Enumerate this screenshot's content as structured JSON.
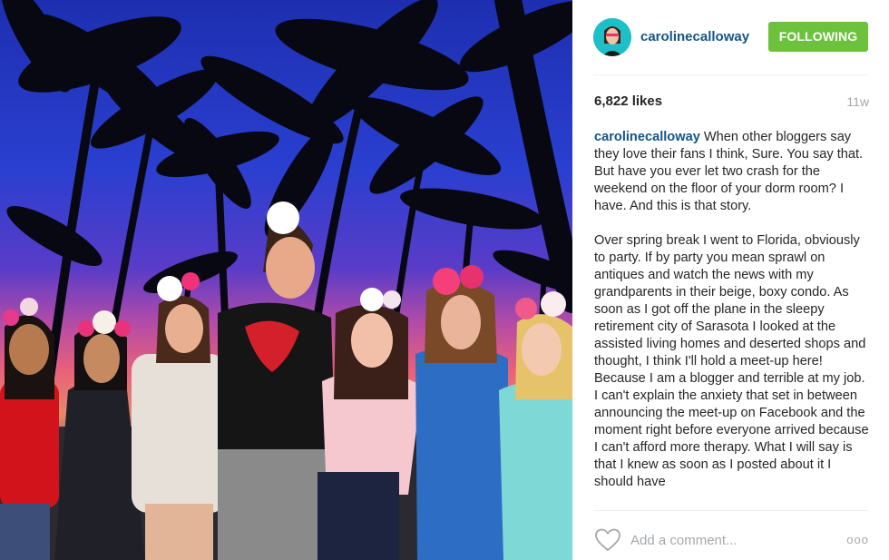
{
  "post": {
    "username": "carolinecalloway",
    "follow_label": "FOLLOWING",
    "likes": "6,822 likes",
    "time_ago": "11w",
    "caption_username": "carolinecalloway",
    "caption_lines": [
      " When other bloggers say they love their fans I think, Sure. You say that. But have you ever let two crash for the weekend on the floor of your dorm room? I have. And this is that story.",
      "Over spring break I went to Florida, obviously to party. If by party you mean sprawl on antiques and watch the news with my grandparents in their beige, boxy condo. As soon as I got off the plane in the sleepy retirement city of Sarasota I looked at the assisted living homes and deserted shops and thought, I think I'll hold a meet-up here! Because I am a blogger and terrible at my job.",
      "I can't explain the anxiety that set in between announcing the meet-up on Facebook and the moment right before everyone arrived because I can't afford more therapy. What I will say is that I knew as soon as I posted about it I should have"
    ]
  },
  "comment": {
    "placeholder": "Add a comment...",
    "more_label": "ooo"
  },
  "icons": {
    "heart": "heart-icon",
    "more": "more-options-icon"
  },
  "colors": {
    "follow_green": "#6cc23c",
    "username_blue": "#125688",
    "muted_gray": "#a5a7aa"
  }
}
